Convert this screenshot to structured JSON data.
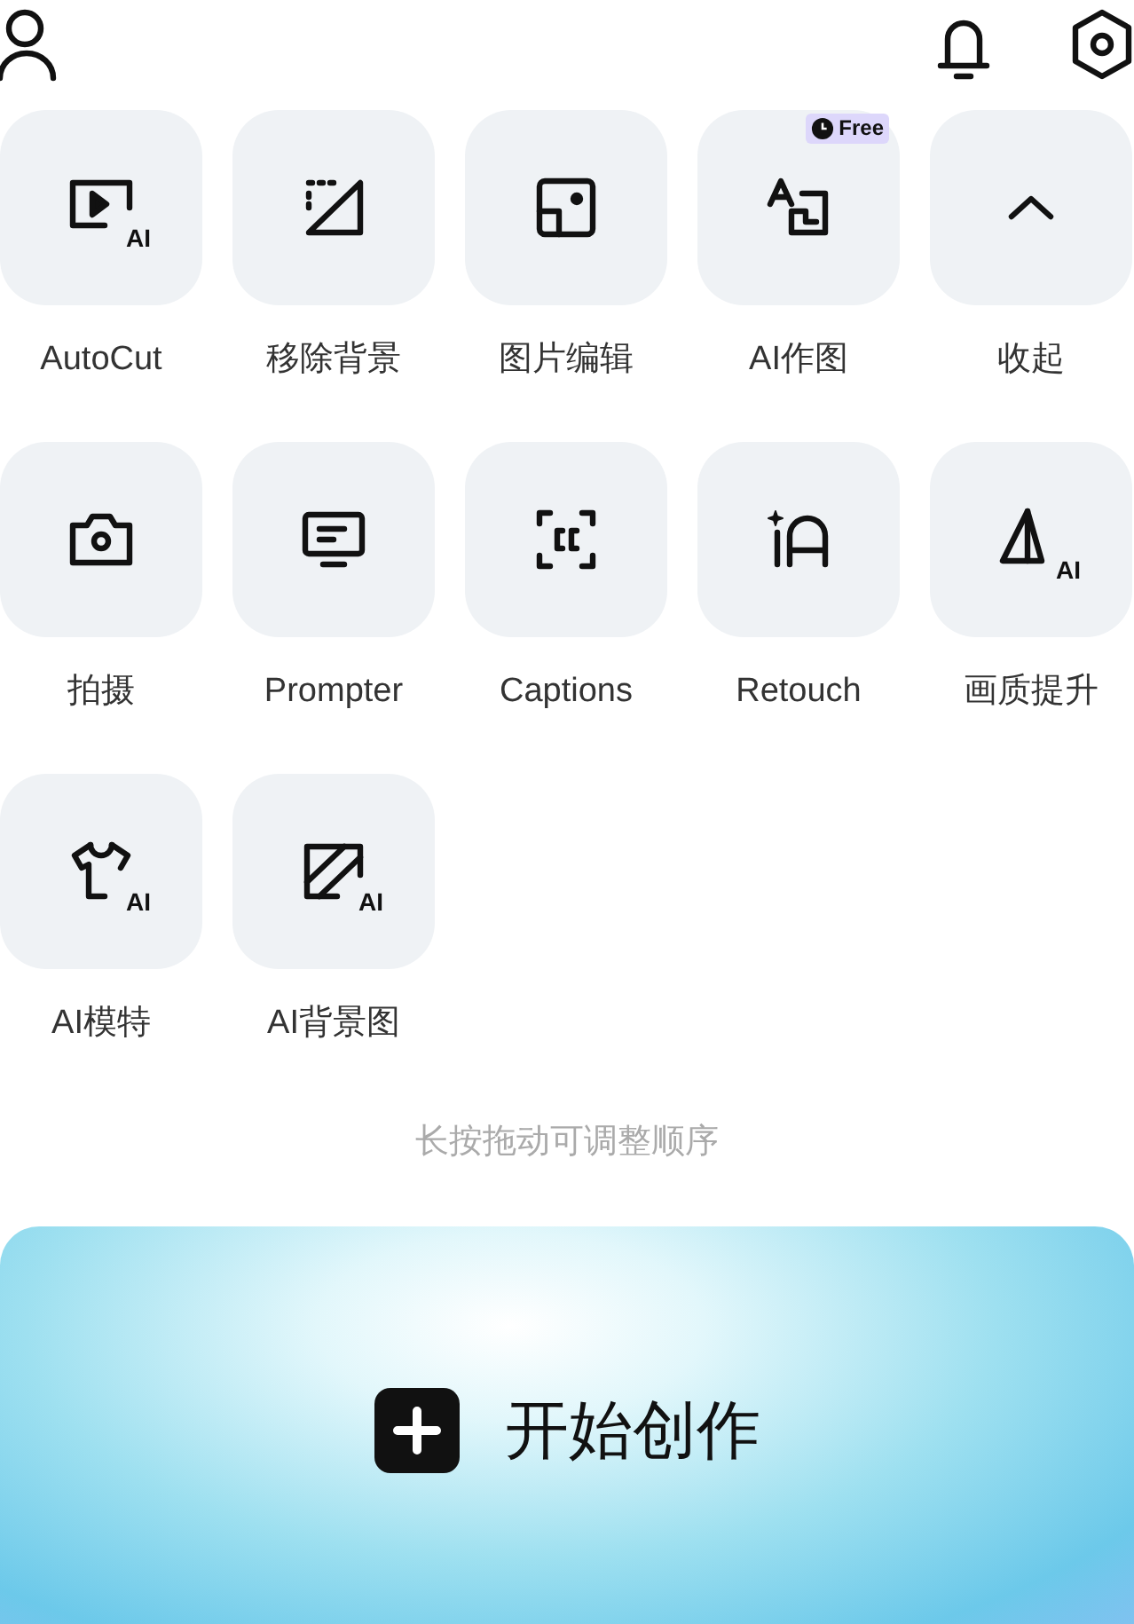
{
  "tools": [
    {
      "label": "AutoCut",
      "icon_tag": "AI"
    },
    {
      "label": "移除背景"
    },
    {
      "label": "图片编辑"
    },
    {
      "label": "AI作图",
      "badge": "Free"
    },
    {
      "label": "收起"
    },
    {
      "label": "拍摄"
    },
    {
      "label": "Prompter"
    },
    {
      "label": "Captions"
    },
    {
      "label": "Retouch"
    },
    {
      "label": "画质提升",
      "icon_tag": "AI"
    },
    {
      "label": "AI模特",
      "icon_tag": "AI"
    },
    {
      "label": "AI背景图",
      "icon_tag": "AI"
    }
  ],
  "hint": "长按拖动可调整顺序",
  "create_button": {
    "label": "开始创作"
  }
}
